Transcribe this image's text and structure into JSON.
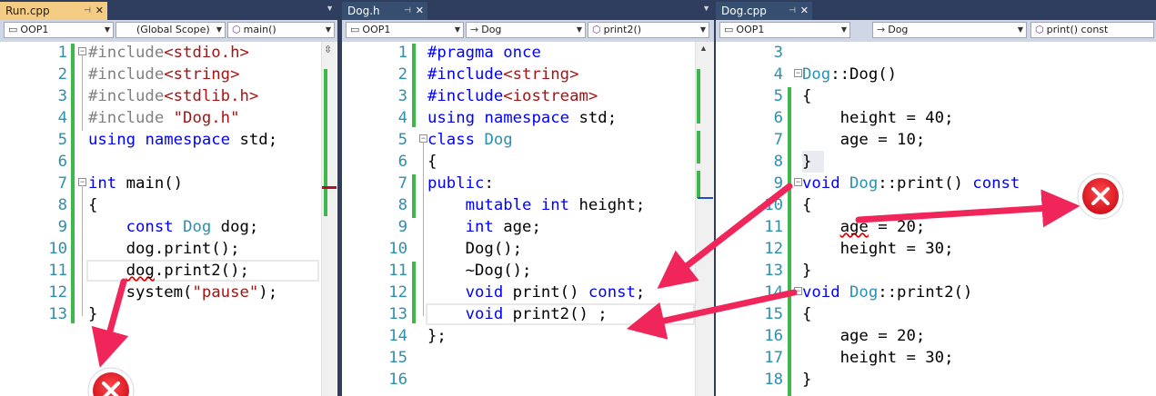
{
  "panes": [
    {
      "tab": "Run.cpp",
      "nav": [
        "OOP1",
        "(Global Scope)",
        "main()"
      ],
      "lines": [
        {
          "n": "1",
          "html": "<span class='pp'>#include</span><span class='st'>&lt;stdio.h&gt;</span>"
        },
        {
          "n": "2",
          "html": "<span class='pp'>#include</span><span class='st'>&lt;string&gt;</span>"
        },
        {
          "n": "3",
          "html": "<span class='pp'>#include</span><span class='st'>&lt;stdlib.h&gt;</span>"
        },
        {
          "n": "4",
          "html": "<span class='pp'>#include</span> <span class='st'>\"Dog.h\"</span>"
        },
        {
          "n": "5",
          "html": "<span class='kw'>using</span> <span class='kw'>namespace</span> std;"
        },
        {
          "n": "6",
          "html": ""
        },
        {
          "n": "7",
          "html": "<span class='kw'>int</span> main()"
        },
        {
          "n": "8",
          "html": "{"
        },
        {
          "n": "9",
          "html": "    <span class='kw'>const</span> <span class='ty'>Dog</span> dog;"
        },
        {
          "n": "10",
          "html": "    dog.print();"
        },
        {
          "n": "11",
          "html": "    <span class='sq'>dog</span>.print2();"
        },
        {
          "n": "12",
          "html": "    system(<span class='st'>\"pause\"</span>);"
        },
        {
          "n": "13",
          "html": "}"
        }
      ]
    },
    {
      "tab": "Dog.h",
      "nav": [
        "OOP1",
        "Dog",
        "print2()"
      ],
      "lines": [
        {
          "n": "1",
          "html": "<span class='kw'>#pragma</span> <span class='kw'>once</span>"
        },
        {
          "n": "2",
          "html": "<span class='kw'>#include</span><span class='st'>&lt;string&gt;</span>"
        },
        {
          "n": "3",
          "html": "<span class='kw'>#include</span><span class='st'>&lt;iostream&gt;</span>"
        },
        {
          "n": "4",
          "html": "<span class='kw'>using</span> <span class='kw'>namespace</span> std;"
        },
        {
          "n": "5",
          "html": "<span class='kw'>class</span> <span class='ty'>Dog</span>"
        },
        {
          "n": "6",
          "html": "{"
        },
        {
          "n": "7",
          "html": "<span class='kw'>public</span>:"
        },
        {
          "n": "8",
          "html": "    <span class='kw'>mutable</span> <span class='kw'>int</span> height;"
        },
        {
          "n": "9",
          "html": "    <span class='kw'>int</span> age;"
        },
        {
          "n": "10",
          "html": "    Dog();"
        },
        {
          "n": "11",
          "html": "    ~Dog();"
        },
        {
          "n": "12",
          "html": "    <span class='kw'>void</span> print() <span class='kw'>const</span>;"
        },
        {
          "n": "13",
          "html": "    <span class='kw'>void</span> print2() ;"
        },
        {
          "n": "14",
          "html": "};"
        },
        {
          "n": "15",
          "html": ""
        },
        {
          "n": "16",
          "html": ""
        }
      ]
    },
    {
      "tab": "Dog.cpp",
      "nav": [
        "OOP1",
        "Dog",
        "print() const"
      ],
      "lines": [
        {
          "n": "3",
          "html": ""
        },
        {
          "n": "4",
          "html": "<span class='ty'>Dog</span>::Dog()"
        },
        {
          "n": "5",
          "html": "{"
        },
        {
          "n": "6",
          "html": "    height = 40;"
        },
        {
          "n": "7",
          "html": "    age = 10;"
        },
        {
          "n": "8",
          "html": "}"
        },
        {
          "n": "9",
          "html": "<span class='kw'>void</span> <span class='ty'>Dog</span>::print() <span class='kw'>const</span>"
        },
        {
          "n": "10",
          "html": "{"
        },
        {
          "n": "11",
          "html": "    <span class='sq'>age</span> = 20;"
        },
        {
          "n": "12",
          "html": "    height = 30;"
        },
        {
          "n": "13",
          "html": "}"
        },
        {
          "n": "14",
          "html": "<span class='kw'>void</span> <span class='ty'>Dog</span>::print2()"
        },
        {
          "n": "15",
          "html": "{"
        },
        {
          "n": "16",
          "html": "    age = 20;"
        },
        {
          "n": "17",
          "html": "    height = 30;"
        },
        {
          "n": "18",
          "html": "}"
        }
      ]
    }
  ],
  "colors": {
    "arrow": "#f0265a",
    "change_bar": "#3fb84a",
    "active_tab": "#f5cc84",
    "error_badge": "#e0101c"
  },
  "annotations": {
    "arrow_count": 4,
    "error_badges": 2
  }
}
